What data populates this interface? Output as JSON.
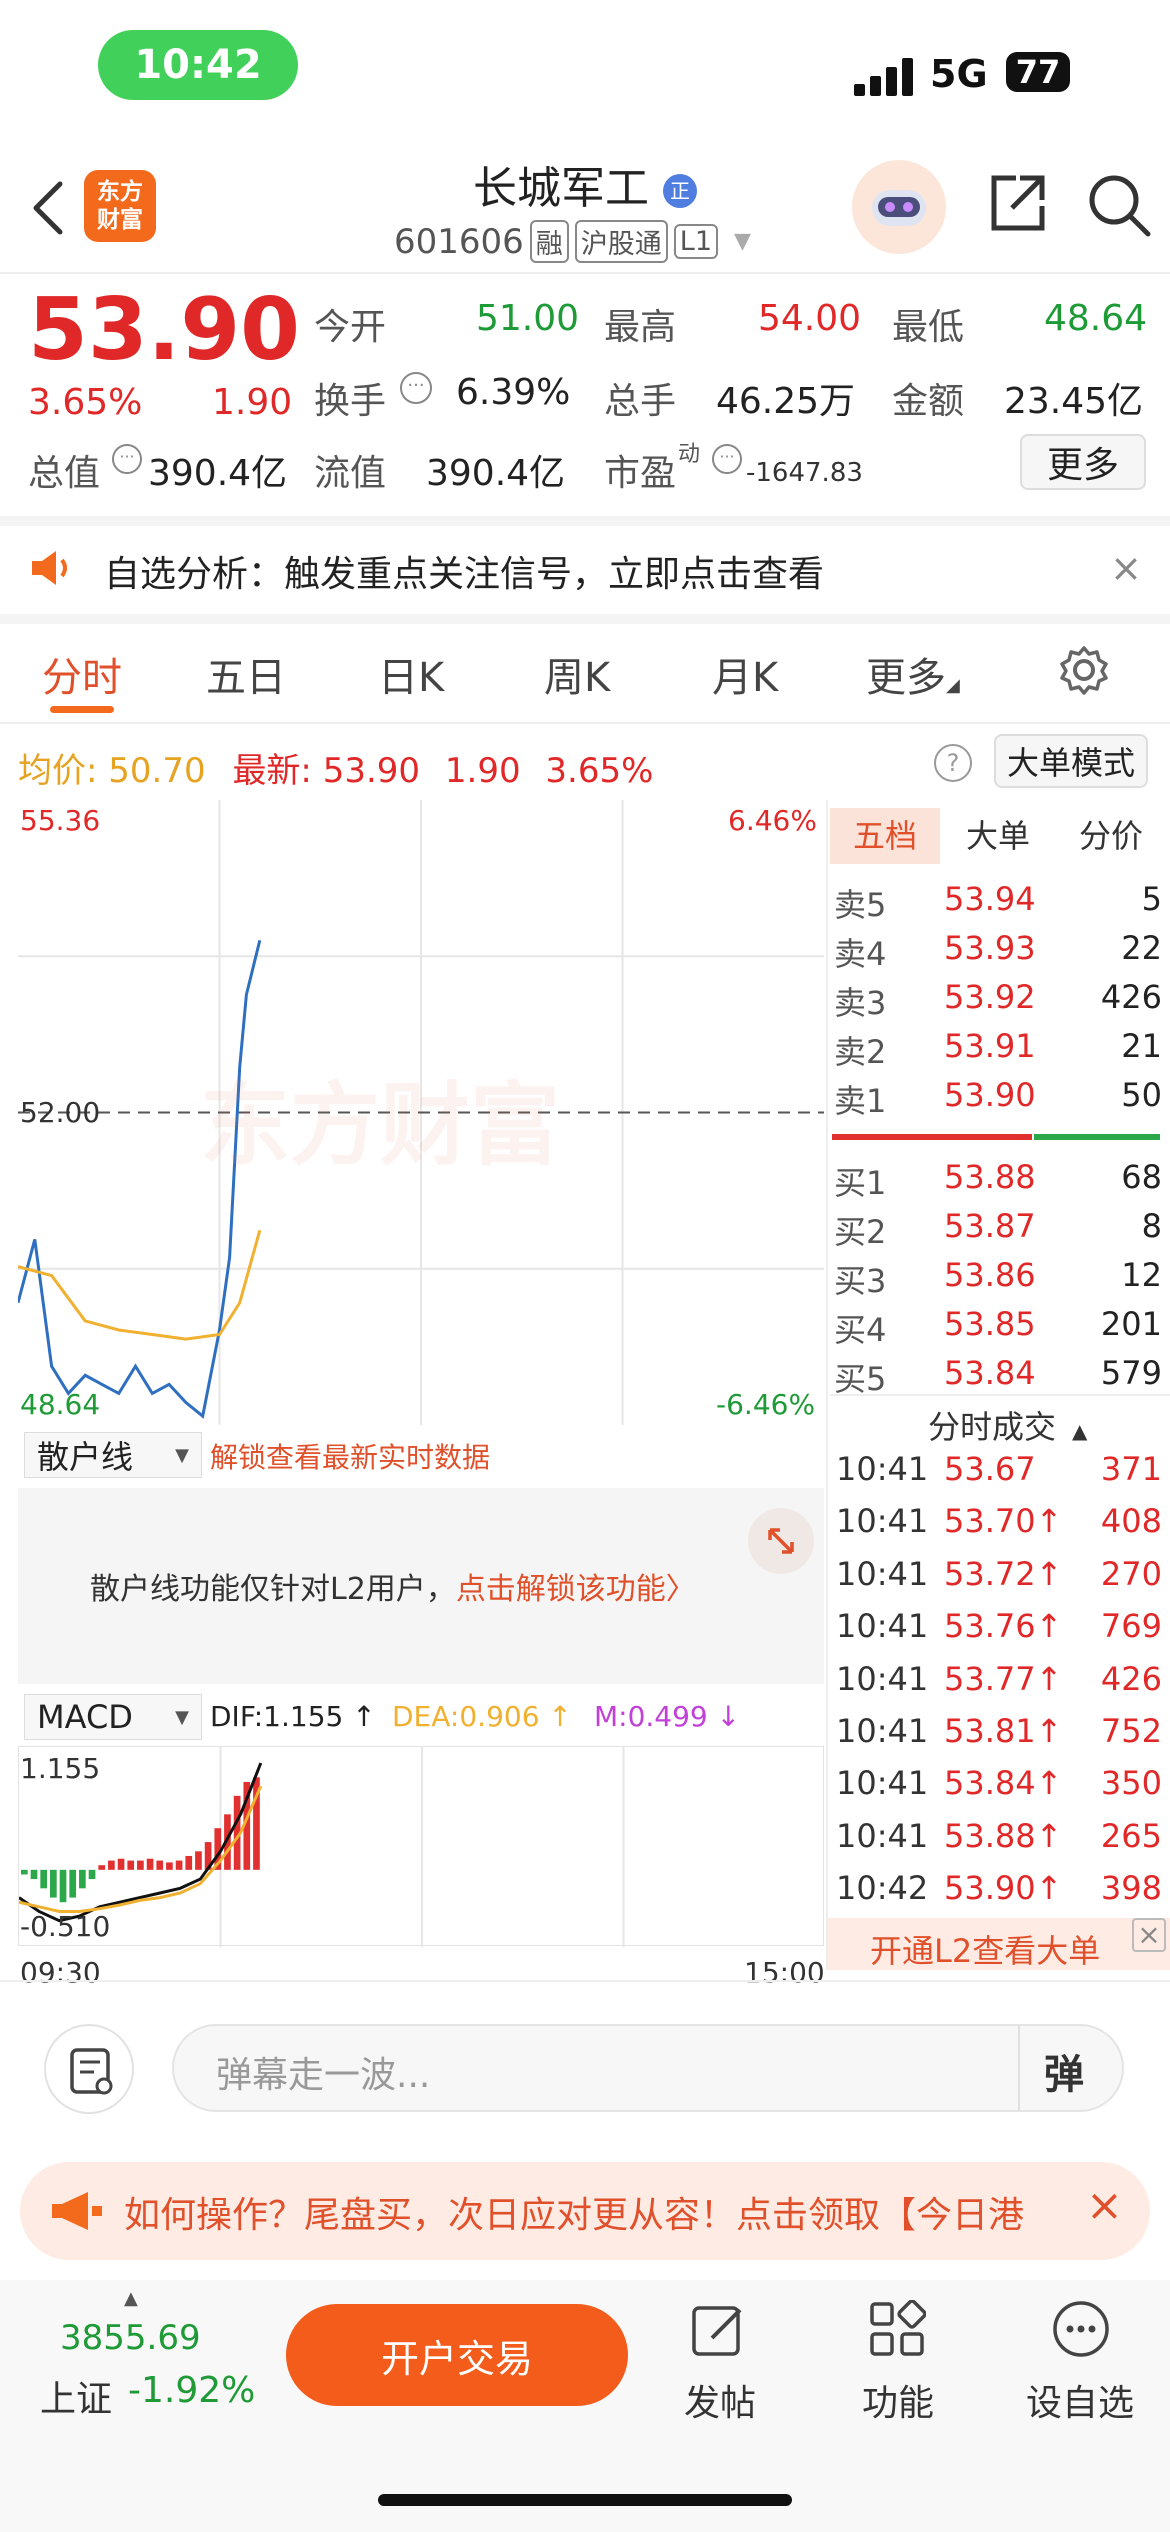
{
  "status_bar": {
    "time": "10:42",
    "network": "5G",
    "battery": "77"
  },
  "header": {
    "logo_line1": "东方",
    "logo_line2": "财富",
    "stock_name": "长城军工",
    "code": "601606",
    "tags": [
      "融",
      "沪股通",
      "L1"
    ]
  },
  "quote": {
    "price": "53.90",
    "change_pct": "3.65%",
    "change": "1.90",
    "open_label": "今开",
    "open": "51.00",
    "high_label": "最高",
    "high": "54.00",
    "low_label": "最低",
    "low": "48.64",
    "turnover_label": "换手",
    "turnover": "6.39%",
    "volume_label": "总手",
    "volume": "46.25万",
    "amount_label": "金额",
    "amount": "23.45亿",
    "mktcap_label": "总值",
    "mktcap": "390.4亿",
    "float_label": "流值",
    "float": "390.4亿",
    "pe_label": "市盈",
    "pe_sup": "动",
    "pe": "-1647.83",
    "more": "更多"
  },
  "notice": {
    "text": "自选分析：触发重点关注信号，立即点击查看"
  },
  "tabs": [
    "分时",
    "五日",
    "日K",
    "周K",
    "月K",
    "更多"
  ],
  "avg_row": {
    "avg_label": "均价:",
    "avg": "50.70",
    "last_label": "最新:",
    "last": "53.90",
    "chg": "1.90",
    "pct": "3.65%",
    "mode_button": "大单模式"
  },
  "chart_labels": {
    "top_left": "55.36",
    "top_right": "6.46%",
    "mid_left": "52.00",
    "bottom_left": "48.64",
    "bottom_right": "-6.46%",
    "watermark": "东方财富"
  },
  "chart_data": [
    {
      "type": "line",
      "series": [
        {
          "name": "price",
          "x": [
            "09:30",
            "09:35",
            "09:40",
            "09:45",
            "09:50",
            "09:55",
            "10:00",
            "10:05",
            "10:10",
            "10:15",
            "10:20",
            "10:25",
            "10:30",
            "10:33",
            "10:36",
            "10:38",
            "10:40",
            "10:42"
          ],
          "values": [
            49.9,
            50.6,
            49.2,
            48.9,
            49.1,
            49.0,
            48.9,
            49.2,
            48.9,
            49.0,
            48.8,
            48.65,
            49.6,
            50.4,
            52.5,
            53.3,
            53.6,
            53.9
          ]
        },
        {
          "name": "avg",
          "x": [
            "09:30",
            "09:40",
            "09:50",
            "10:00",
            "10:10",
            "10:20",
            "10:30",
            "10:36",
            "10:42"
          ],
          "values": [
            50.3,
            50.2,
            49.7,
            49.6,
            49.55,
            49.5,
            49.55,
            49.9,
            50.7
          ]
        }
      ],
      "ylim": [
        48.64,
        55.36
      ],
      "xlim": [
        "09:30",
        "15:00"
      ]
    },
    {
      "type": "bar",
      "series": [
        {
          "name": "M",
          "values": [
            -0.05,
            -0.1,
            -0.2,
            -0.3,
            -0.35,
            -0.3,
            -0.2,
            -0.1,
            0.05,
            0.1,
            0.12,
            0.1,
            0.1,
            0.12,
            0.1,
            0.08,
            0.1,
            0.15,
            0.2,
            0.3,
            0.45,
            0.6,
            0.8,
            0.95,
            1.0
          ]
        },
        {
          "name": "DIF",
          "values": [
            -0.3,
            -0.45,
            -0.55,
            -0.5,
            -0.4,
            -0.35,
            -0.3,
            -0.25,
            -0.2,
            -0.1,
            0.2,
            0.6,
            1.155
          ]
        },
        {
          "name": "DEA",
          "values": [
            -0.35,
            -0.4,
            -0.45,
            -0.45,
            -0.42,
            -0.38,
            -0.33,
            -0.3,
            -0.25,
            -0.15,
            0.1,
            0.4,
            0.906
          ]
        }
      ],
      "ylim": [
        -0.51,
        1.155
      ]
    }
  ],
  "scatter_panel": {
    "selector": "散户线",
    "unlock_hint": "解锁查看最新实时数据",
    "lock_text_a": "散户线功能仅针对L2用户，",
    "lock_text_b": "点击解锁该功能〉"
  },
  "macd": {
    "selector": "MACD",
    "dif": "DIF:1.155 ↑",
    "dea": "DEA:0.906 ↑",
    "m": "M:0.499 ↓",
    "top": "1.155",
    "bottom": "-0.510",
    "x_start": "09:30",
    "x_end": "15:00"
  },
  "order_book": {
    "tabs": [
      "五档",
      "大单",
      "分价"
    ],
    "asks": [
      {
        "label": "卖5",
        "price": "53.94",
        "vol": "5"
      },
      {
        "label": "卖4",
        "price": "53.93",
        "vol": "22"
      },
      {
        "label": "卖3",
        "price": "53.92",
        "vol": "426"
      },
      {
        "label": "卖2",
        "price": "53.91",
        "vol": "21"
      },
      {
        "label": "卖1",
        "price": "53.90",
        "vol": "50"
      }
    ],
    "bids": [
      {
        "label": "买1",
        "price": "53.88",
        "vol": "68"
      },
      {
        "label": "买2",
        "price": "53.87",
        "vol": "8"
      },
      {
        "label": "买3",
        "price": "53.86",
        "vol": "12"
      },
      {
        "label": "买4",
        "price": "53.85",
        "vol": "201"
      },
      {
        "label": "买5",
        "price": "53.84",
        "vol": "579"
      }
    ],
    "ticks_title": "分时成交",
    "ticks": [
      {
        "time": "10:41",
        "price": "53.67",
        "vol": "371"
      },
      {
        "time": "10:41",
        "price": "53.70↑",
        "vol": "408"
      },
      {
        "time": "10:41",
        "price": "53.72↑",
        "vol": "270"
      },
      {
        "time": "10:41",
        "price": "53.76↑",
        "vol": "769"
      },
      {
        "time": "10:41",
        "price": "53.77↑",
        "vol": "426"
      },
      {
        "time": "10:41",
        "price": "53.81↑",
        "vol": "752"
      },
      {
        "time": "10:41",
        "price": "53.84↑",
        "vol": "350"
      },
      {
        "time": "10:41",
        "price": "53.88↑",
        "vol": "265"
      },
      {
        "time": "10:42",
        "price": "53.90↑",
        "vol": "398"
      }
    ],
    "l2_banner": "开通L2查看大单"
  },
  "comment": {
    "placeholder": "弹幕走一波...",
    "danmu": "弹"
  },
  "promo": {
    "text": "如何操作？尾盘买，次日应对更从容！点击领取【今日港"
  },
  "bottom": {
    "index_value": "3855.69",
    "index_name": "上证",
    "index_pct": "-1.92%",
    "open_button": "开户交易",
    "nav": [
      "发帖",
      "功能",
      "设自选"
    ]
  },
  "colors": {
    "up": "#e02828",
    "down": "#1e9a36",
    "accent": "#f36a1d",
    "price_line": "#2f6fc0",
    "avg_line": "#f0b030"
  }
}
